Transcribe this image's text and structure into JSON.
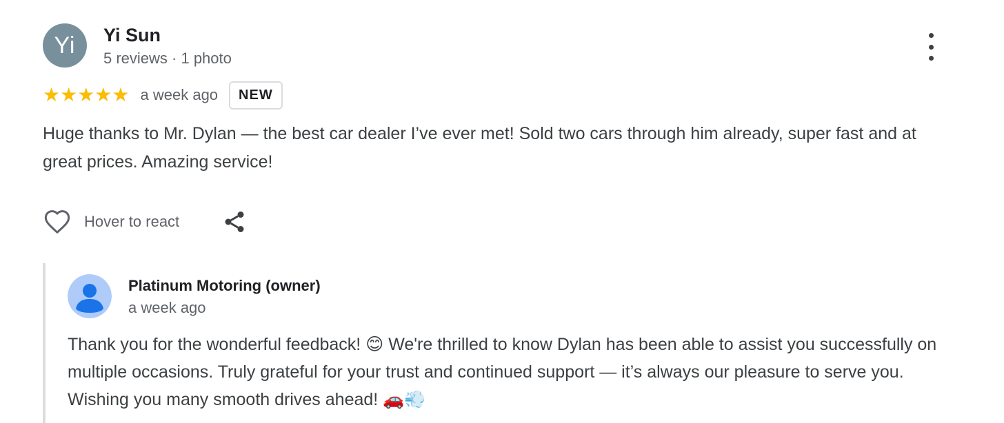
{
  "review": {
    "author_initials": "Yi",
    "author_name": "Yi Sun",
    "author_meta": "5 reviews · 1 photo",
    "rating": 5,
    "stars": "★★★★★",
    "date": "a week ago",
    "badge": "NEW",
    "text": "Huge thanks to Mr. Dylan — the best car dealer I’ve ever met! Sold two cars through him already, super fast and at great prices. Amazing service!",
    "react_label": "Hover to react",
    "avatar_color": "#78909c",
    "star_color": "#fbbc04"
  },
  "owner_reply": {
    "name": "Platinum Motoring (owner)",
    "date": "a week ago",
    "text": "Thank you for the wonderful feedback! 😊 We're thrilled to know Dylan has been able to assist you successfully on multiple occasions. Truly grateful for your trust and continued support — it’s always our pleasure to serve you. Wishing you many smooth drives ahead! 🚗💨",
    "avatar_icon": "person-icon",
    "avatar_color": "#aecbfa"
  },
  "icons": {
    "more": "more-vertical-icon",
    "heart": "heart-icon",
    "share": "share-icon"
  }
}
